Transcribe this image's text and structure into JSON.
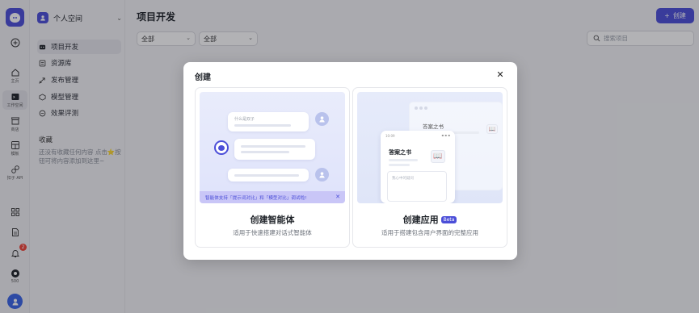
{
  "rail": {
    "items": [
      {
        "label": "",
        "icon": "add-icon"
      },
      {
        "label": "主页",
        "icon": "home-icon"
      },
      {
        "label": "工作空间",
        "icon": "workspace-icon"
      },
      {
        "label": "商店",
        "icon": "store-icon"
      },
      {
        "label": "模板",
        "icon": "template-icon"
      },
      {
        "label": "扣子 API",
        "icon": "api-icon"
      }
    ],
    "bottom": [
      {
        "label": "",
        "icon": "apps-icon"
      },
      {
        "label": "",
        "icon": "document-icon"
      },
      {
        "label": "",
        "icon": "bell-icon",
        "badge": "2"
      },
      {
        "label": "500",
        "icon": "credits-icon"
      }
    ]
  },
  "sidebar": {
    "workspace_name": "个人空间",
    "items": [
      {
        "label": "项目开发",
        "icon": "dev-icon",
        "active": true
      },
      {
        "label": "资源库",
        "icon": "library-icon"
      },
      {
        "label": "发布管理",
        "icon": "publish-icon"
      },
      {
        "label": "模型管理",
        "icon": "model-icon"
      },
      {
        "label": "效果评测",
        "icon": "evaluate-icon"
      }
    ],
    "favorites_title": "收藏",
    "favorites_empty": "还没有收藏任何内容 点击⭐按钮可将内容添加到这里~"
  },
  "main": {
    "title": "项目开发",
    "create_label": "创建",
    "filter1": "全部",
    "filter2": "全部",
    "search_placeholder": "搜索项目"
  },
  "modal": {
    "title": "创建",
    "cards": [
      {
        "title": "创建智能体",
        "desc": "适用于快速搭建对话式智能体",
        "preview_question": "什么是双子",
        "tip": "智能体支持「提示词对比」和「模型对比」调试啦!"
      },
      {
        "title": "创建应用",
        "badge": "Beta",
        "desc": "适用于搭建包含用户界面的完整应用",
        "preview_time": "10:09",
        "preview_back_title": "答案之书",
        "preview_front_title": "答案之书",
        "preview_input": "我心中的疑问"
      }
    ]
  },
  "colors": {
    "accent": "#4b4ed8",
    "badge_red": "#f04438",
    "overlay": "rgba(20,22,30,0.33)"
  }
}
